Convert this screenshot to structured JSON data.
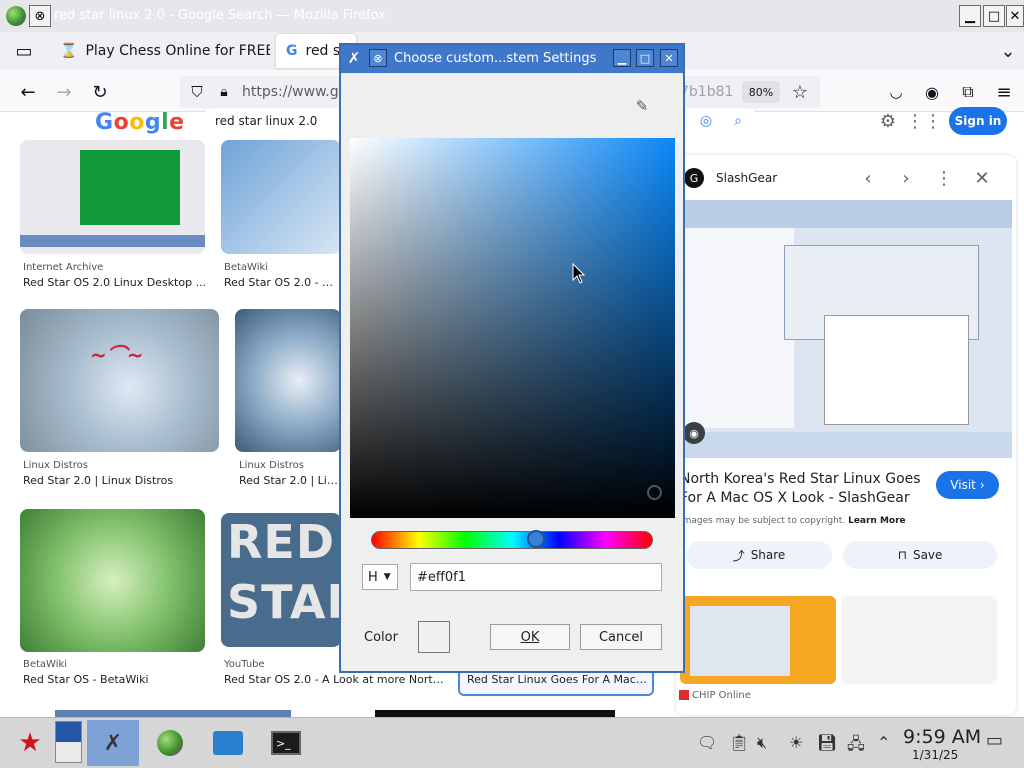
{
  "firefox": {
    "window_title": "red star linux 2.0 - Google Search — Mozilla Firefox",
    "tabs": [
      {
        "label": "Play Chess Online for FREE"
      },
      {
        "label": "red st"
      }
    ],
    "url": "https://www.go",
    "url_tail": "7b1b81",
    "zoom": "80%"
  },
  "google": {
    "logo": "Google",
    "search_query": "red star linux 2.0",
    "sign_in": "Sign in"
  },
  "results": [
    {
      "source": "Internet Archive",
      "title": "Red Star OS 2.0 Linux Desktop ..."
    },
    {
      "source": "BetaWiki",
      "title": "Red Star OS 2.0 - Beta"
    },
    {
      "source": "Linux Distros",
      "title": "Red Star 2.0 | Linux Distros"
    },
    {
      "source": "Linux Distros",
      "title": "Red Star 2.0 | Linux"
    },
    {
      "source": "BetaWiki",
      "title": "Red Star OS - BetaWiki"
    },
    {
      "source": "YouTube",
      "title": "Red Star OS 2.0 - A Look at more North ..."
    },
    {
      "source": "",
      "title": "Red Star Linux Goes For A Mac ..."
    }
  ],
  "thumb_text": {
    "red": "RED",
    "star": "STAR"
  },
  "panel": {
    "source": "SlashGear",
    "headline_1": "North Korea's Red Star Linux Goes",
    "headline_2": "For A Mac OS X Look - SlashGear",
    "copyright": "Images may be subject to copyright.",
    "learn_more": "Learn More",
    "visit": "Visit",
    "share": "Share",
    "save": "Save",
    "related_source": "CHIP Online"
  },
  "dialog": {
    "title": "Choose custom...stem Settings",
    "mode": "H",
    "hex_value": "#eff0f1",
    "color_label": "Color",
    "ok": "OK",
    "cancel": "Cancel",
    "swatch_color": "#eff0f1",
    "hue_color": "#0a88f8"
  },
  "taskbar": {
    "time": "9:59 AM",
    "date": "1/31/25"
  }
}
